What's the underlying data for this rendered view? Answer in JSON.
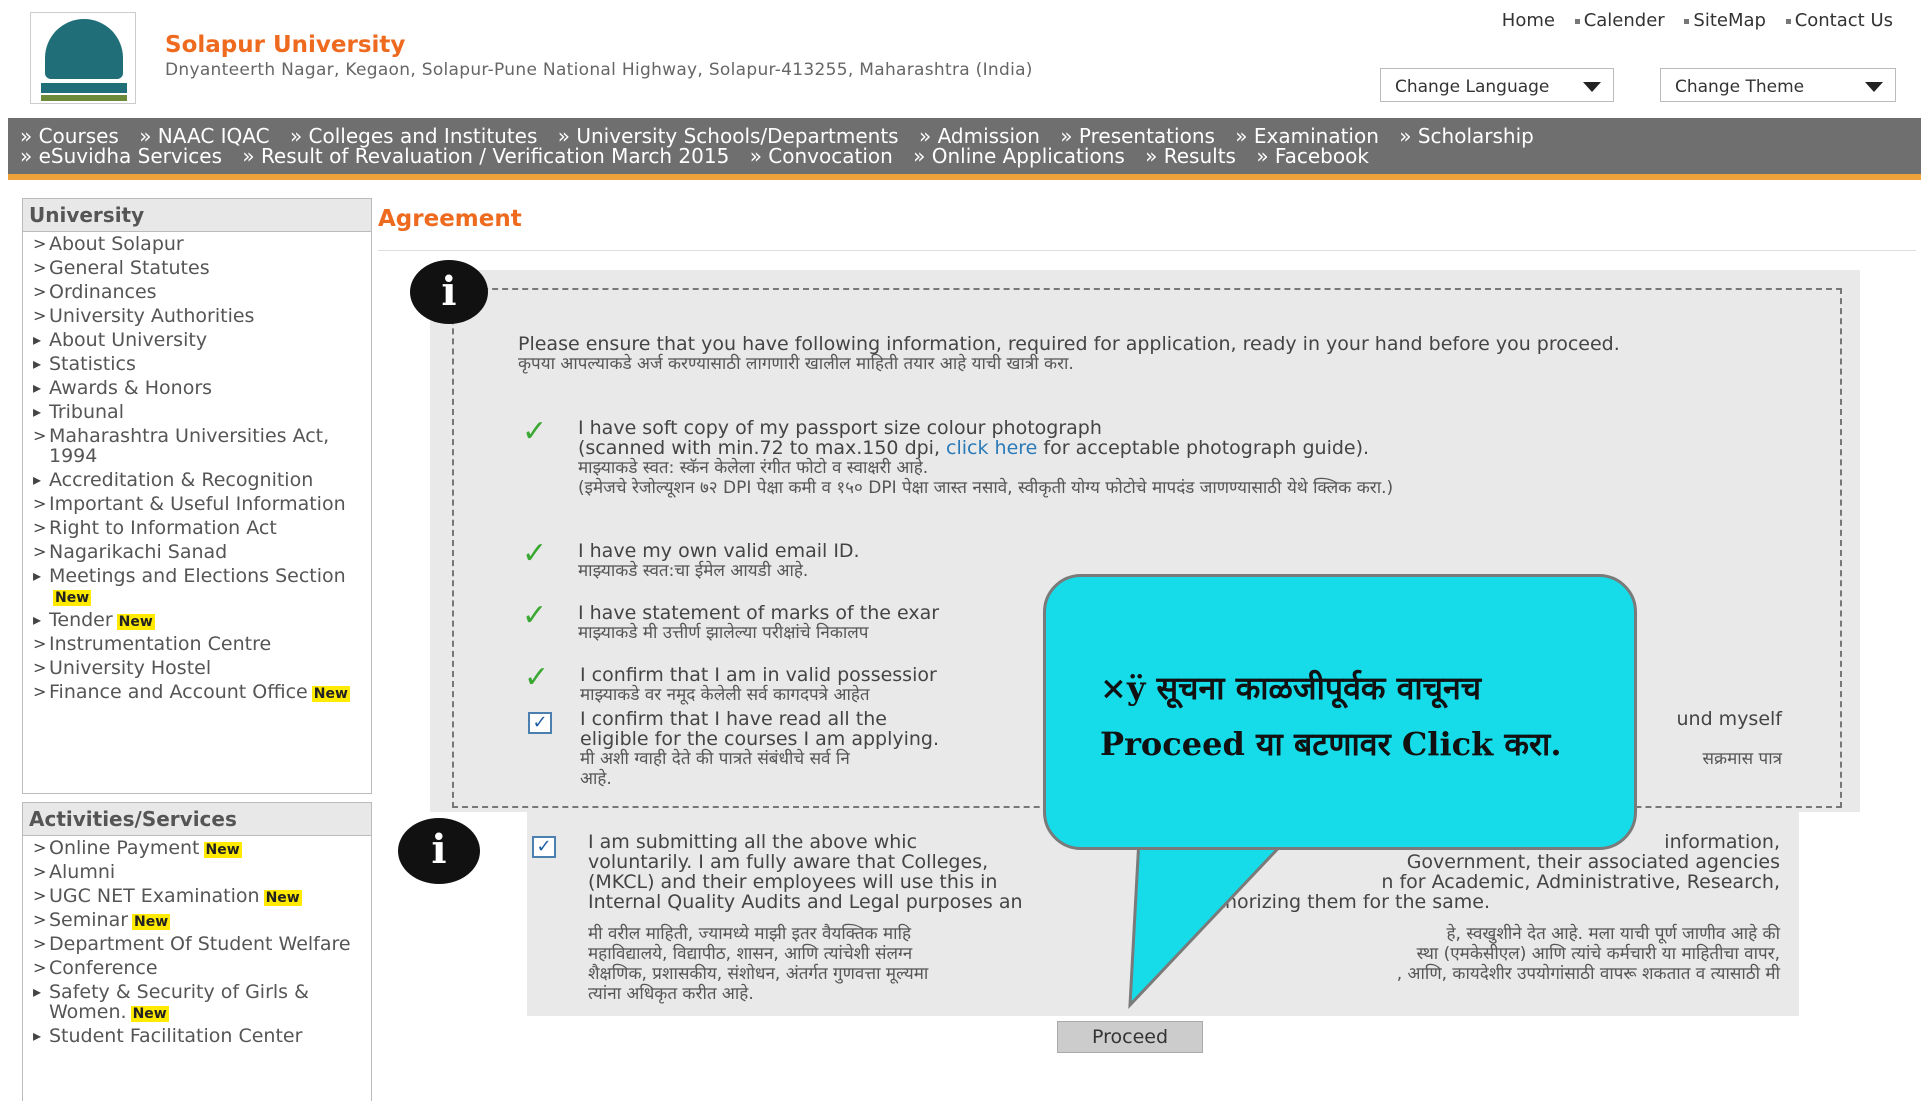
{
  "header": {
    "university_name": "Solapur University",
    "address": "Dnyanteerth Nagar, Kegaon, Solapur-Pune National Highway, Solapur-413255, Maharashtra (India)",
    "top_links": [
      "Home",
      "Calender",
      "SiteMap",
      "Contact Us"
    ],
    "change_language": "Change Language",
    "change_theme": "Change Theme"
  },
  "nav": {
    "items": [
      "» Courses",
      "» NAAC IQAC",
      "» Colleges and Institutes",
      "» University Schools/Departments",
      "» Admission",
      "» Presentations",
      "» Examination",
      "» Scholarship",
      "» eSuvidha Services",
      "» Result of Revaluation / Verification March 2015",
      "» Convocation",
      "» Online Applications",
      "» Results",
      "» Facebook"
    ]
  },
  "sidebar": {
    "university_heading": "University",
    "university_items": [
      {
        "label": "About Solapur",
        "marker": ">"
      },
      {
        "label": "General Statutes",
        "marker": ">"
      },
      {
        "label": "Ordinances",
        "marker": ">"
      },
      {
        "label": "University Authorities",
        "marker": ">"
      },
      {
        "label": "About University",
        "marker": "▸"
      },
      {
        "label": "Statistics",
        "marker": "▸"
      },
      {
        "label": "Awards & Honors",
        "marker": "▸"
      },
      {
        "label": "Tribunal",
        "marker": "▸"
      },
      {
        "label": "Maharashtra Universities Act, 1994",
        "marker": ">"
      },
      {
        "label": "Accreditation & Recognition",
        "marker": "▸"
      },
      {
        "label": "Important & Useful Information",
        "marker": ">"
      },
      {
        "label": "Right to Information Act",
        "marker": ">"
      },
      {
        "label": "Nagarikachi Sanad",
        "marker": ">"
      },
      {
        "label": "Meetings and Elections Section",
        "marker": "▸",
        "new": "New"
      },
      {
        "label": "Tender",
        "marker": "▸",
        "new": "New"
      },
      {
        "label": "Instrumentation Centre",
        "marker": ">"
      },
      {
        "label": "University Hostel",
        "marker": ">"
      },
      {
        "label": "Finance and Account Office",
        "marker": ">",
        "new": "New"
      }
    ],
    "activities_heading": "Activities/Services",
    "activities_items": [
      {
        "label": "Online Payment",
        "marker": ">",
        "new": "New"
      },
      {
        "label": "Alumni",
        "marker": ">"
      },
      {
        "label": "UGC NET Examination",
        "marker": ">",
        "new": "New"
      },
      {
        "label": "Seminar",
        "marker": ">",
        "new": "New"
      },
      {
        "label": "Department Of Student Welfare",
        "marker": ">"
      },
      {
        "label": "Conference",
        "marker": ">"
      },
      {
        "label": "Safety & Security of Girls & Women.",
        "marker": "▸",
        "new": "New"
      },
      {
        "label": "Student Facilitation Center",
        "marker": "▸"
      }
    ]
  },
  "agreement": {
    "title": "Agreement",
    "intro_en": "Please ensure that you have following information, required for application, ready in your hand before you proceed.",
    "intro_mr": "कृपया आपल्याकडे अर्ज करण्यासाठी लागणारी खालील माहिती तयार आहे याची खात्री करा.",
    "photo_en": "I have soft copy of my passport size colour photograph",
    "photo_en2_a": "(scanned with min.72 to max.150 dpi, ",
    "photo_link": "click here",
    "photo_en2_b": " for acceptable photograph guide).",
    "photo_mr": "माझ्याकडे स्वत: स्कॅन केलेला रंगीत फोटो व स्वाक्षरी आहे.",
    "photo_mr2": "(इमेजचे रेजोल्यूशन ७२ DPI पेक्षा कमी व १५० DPI पेक्षा जास्त नसावे, स्वीकृती योग्य फोटोचे मापदंड जाणण्यासाठी येथे क्लिक करा.)",
    "email_en": "I have my own valid email ID.",
    "email_mr": "माझ्याकडे स्वत:चा ईमेल आयडी आहे.",
    "marks_en": "I have statement of marks of the exar",
    "marks_mr": "माझ्याकडे मी उत्तीर्ण झालेल्या परीक्षांचे निकालप",
    "confirm_en": "I confirm that I am in valid possessior",
    "confirm_mr": "माझ्याकडे वर नमूद केलेली सर्व कागदपत्रे आहेत",
    "read_en": "I confirm that I have read all the",
    "read_en_tail": "und myself",
    "read_en2": "eligible for the courses I am applying.",
    "read_mr": "मी अशी ग्वाही देते की पात्रते संबंधीचे सर्व नि",
    "read_mr_tail": "सक्रमास पात्र",
    "read_mr2": "आहे.",
    "submit_en_1": "I am submitting all the above whic",
    "submit_en_1_tail": "information,",
    "submit_en_2": "voluntarily. I am fully aware that Colleges,",
    "submit_en_2_tail": "Government, their associated agencies",
    "submit_en_3": "(MKCL) and their employees will use this in",
    "submit_en_3_tail": "n for Academic, Administrative, Research,",
    "submit_en_4": "Internal Quality Audits and Legal purposes an",
    "submit_en_4_tail": "authorizing them for the same.",
    "submit_mr_1": "मी वरील माहिती, ज्यामध्ये माझी इतर वैयक्तिक माहि",
    "submit_mr_1_tail": "हे, स्वखुशीने देत आहे. मला याची पूर्ण जाणीव आहे की",
    "submit_mr_2": "महाविद्यालये, विद्यापीठ, शासन, आणि त्यांचेशी संलग्न",
    "submit_mr_2_tail": "स्था (एमकेसीएल) आणि त्यांचे कर्मचारी या माहितीचा वापर,",
    "submit_mr_3": "शैक्षणिक, प्रशासकीय, संशोधन, अंतर्गत गुणवत्ता मूल्यमा",
    "submit_mr_3_tail": ", आणि, कायदेशीर उपयोगांसाठी वापरू शकतात व त्यासाठी मी",
    "submit_mr_4": "त्यांना अधिकृत करीत आहे.",
    "proceed_label": "Proceed"
  },
  "callout": {
    "line1_prefix": "×ÿ",
    "line1": "सूचना काळजीपूर्वक वाचूनच",
    "line2": "Proceed या बटणावर Click करा."
  },
  "colors": {
    "accent_orange": "#ee6a1e",
    "nav_gray": "#6f6f6f",
    "callout_cyan": "#16dbe8",
    "check_green": "#3aa832"
  }
}
